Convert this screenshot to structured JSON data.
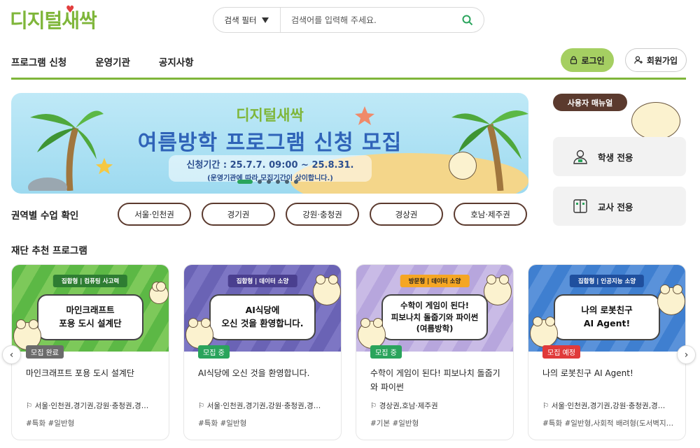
{
  "header": {
    "logo_text": "디지털새싹",
    "search": {
      "filter_label": "검색 필터",
      "placeholder": "검색어를 입력해 주세요."
    },
    "nav": [
      "프로그램 신청",
      "운영기관",
      "공지사항"
    ],
    "login_label": "로그인",
    "signup_label": "회원가입"
  },
  "banner": {
    "logo_text": "디지털새싹",
    "title": "여름방학 프로그램 신청 모집",
    "period": "신청기간 : 25.7.7. 09:00  ~  25.8.31.",
    "note": "(운영기관에 따라 모집기간이 상이합니다.)",
    "slide_count": 6,
    "active_slide": 1
  },
  "regions": {
    "label": "권역별 수업 확인",
    "items": [
      "서울·인천권",
      "경기권",
      "강원·충청권",
      "경상권",
      "호남·제주권"
    ]
  },
  "recommended": {
    "title": "재단 추천 프로그램",
    "cards": [
      {
        "tag": "집합형 | 컴퓨팅 사고력",
        "bubble_line1": "마인크래프트",
        "bubble_line2": "포용 도시 설계단",
        "bubble_line3": "",
        "status": "모집 완료",
        "title": "마인크래프트 포용 도시 설계단",
        "location": "서울·인천권,경기권,강원·충청권,경…",
        "tags": "#특화 #일반형"
      },
      {
        "tag": "집합형 | 데이터 소양",
        "bubble_line1": "AI식당에",
        "bubble_line2": "오신 것을 환영합니다.",
        "bubble_line3": "",
        "status": "모집 중",
        "title": "AI식당에 오신 것을 환영합니다.",
        "location": "서울·인천권,경기권,강원·충청권,경…",
        "tags": "#특화 #일반형"
      },
      {
        "tag": "방문형 | 데이터 소양",
        "bubble_line1": "수학이 게임이 된다!",
        "bubble_line2": "피보나치 돌줍기와 파이썬",
        "bubble_line3": "(여름방학)",
        "status": "모집 중",
        "title": "수학이 게임이 된다! 피보나치 돌줍기와 파이썬",
        "location": "경상권,호남·제주권",
        "tags": "#기본 #일반형"
      },
      {
        "tag": "집합형 | 인공지능 소양",
        "bubble_line1": "나의 로봇친구",
        "bubble_line2": "AI Agent!",
        "bubble_line3": "",
        "status": "모집 예정",
        "title": "나의 로봇친구 AI Agent!",
        "location": "서울·인천권,경기권,강원·충청권,경…",
        "tags": "#특화 #일반형,사회적 배려형(도서벽지…"
      }
    ]
  },
  "side": {
    "manual_label": "사용자 매뉴얼",
    "student_label": "학생 전용",
    "teacher_label": "교사 전용"
  },
  "colors": {
    "brand_green": "#7fb63a",
    "brown": "#5b3a2e",
    "status_done": "#6b6b6b",
    "status_open": "#2aa45c",
    "status_soon": "#e03a3a"
  }
}
